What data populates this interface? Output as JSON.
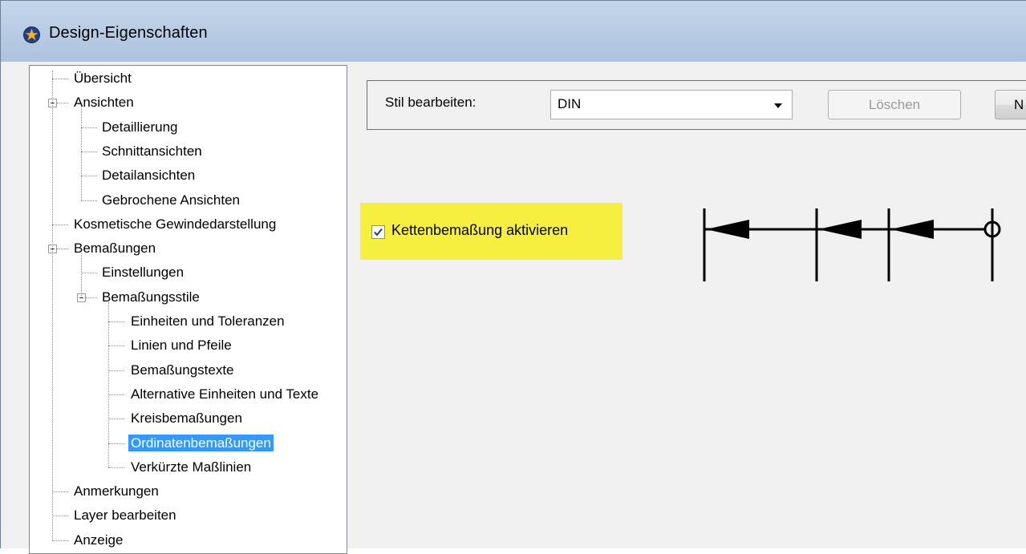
{
  "window": {
    "title": "Design-Eigenschaften",
    "icon": "app-star-icon"
  },
  "tree": {
    "items": [
      {
        "label": "Übersicht",
        "level": 0
      },
      {
        "label": "Ansichten",
        "level": 0,
        "expanded": true
      },
      {
        "label": "Detaillierung",
        "level": 1
      },
      {
        "label": "Schnittansichten",
        "level": 1
      },
      {
        "label": "Detailansichten",
        "level": 1
      },
      {
        "label": "Gebrochene Ansichten",
        "level": 1
      },
      {
        "label": "Kosmetische Gewindedarstellung",
        "level": 0
      },
      {
        "label": "Bemaßungen",
        "level": 0,
        "expanded": true
      },
      {
        "label": "Einstellungen",
        "level": 1
      },
      {
        "label": "Bemaßungsstile",
        "level": 1,
        "expanded": true
      },
      {
        "label": "Einheiten und Toleranzen",
        "level": 2
      },
      {
        "label": "Linien und Pfeile",
        "level": 2
      },
      {
        "label": "Bemaßungstexte",
        "level": 2
      },
      {
        "label": "Alternative Einheiten und Texte",
        "level": 2
      },
      {
        "label": "Kreisbemaßungen",
        "level": 2
      },
      {
        "label": "Ordinatenbemaßungen",
        "level": 2,
        "selected": true
      },
      {
        "label": "Verkürzte Maßlinien",
        "level": 2
      },
      {
        "label": "Anmerkungen",
        "level": 0
      },
      {
        "label": "Layer bearbeiten",
        "level": 0
      },
      {
        "label": "Anzeige",
        "level": 0
      }
    ]
  },
  "style_edit": {
    "label": "Stil bearbeiten:",
    "selected": "DIN",
    "delete_button": "Löschen",
    "new_button_partial": "N"
  },
  "chain_dimension": {
    "label": "Kettenbemaßung aktivieren",
    "checked": true,
    "highlight_color": "#f6ef3e"
  },
  "colors": {
    "selection": "#3399ff",
    "titlebar": "#b9cde4"
  }
}
